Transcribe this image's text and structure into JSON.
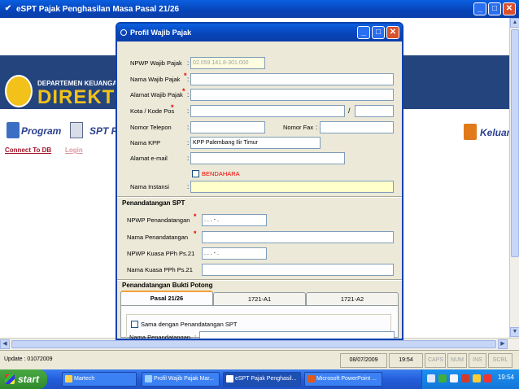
{
  "main": {
    "title": "eSPT Pajak Penghasilan Masa Pasal 21/26",
    "banner_small": "DEPARTEMEN KEUANGAN",
    "banner_big": "DIREKTOR",
    "menu": {
      "program": "Program",
      "spt": "SPT P",
      "keluar": "Keluar"
    },
    "links": {
      "connect": "Connect To DB",
      "login": "Login"
    }
  },
  "dialog": {
    "title": "Profil Wajib Pajak",
    "fields": {
      "npwp_label": "NPWP Wajib Pajak",
      "npwp_value": "02.059.141.8-301.000",
      "nama_label": "Nama Wajib Pajak",
      "nama_value": "",
      "alamat_label": "Alamat Wajib Pajak",
      "alamat_value": "",
      "kota_label": "Kota / Kode Pos",
      "kota_value": "",
      "kodepos_value": "",
      "slash": "/",
      "telp_label": "Nomor Telepon",
      "telp_value": "",
      "fax_label": "Nomor Fax",
      "fax_value": "",
      "kpp_label": "Nama KPP",
      "kpp_value": "KPP Palembang Ilir Timur",
      "email_label": "Alamat e-mail",
      "email_value": "",
      "bendahara_label": "BENDAHARA",
      "instansi_label": "Nama Instansi",
      "instansi_value": ""
    },
    "penandatangan": {
      "section_title": "Penandatangan SPT",
      "npwp_label": "NPWP Penandatangan",
      "npwp_value": "  .   .   .   -   .  ",
      "nama_label": "Nama Penandatangan",
      "nama_value": "",
      "npwp_kuasa_label": "NPWP Kuasa PPh Ps.21",
      "npwp_kuasa_value": "  .   .   .   -   .  ",
      "nama_kuasa_label": "Nama Kuasa PPh Ps.21",
      "nama_kuasa_value": ""
    },
    "bukti_potong": {
      "section_title": "Penandatangan Bukti Potong",
      "tabs": [
        "Pasal 21/26",
        "1721-A1",
        "1721-A2"
      ],
      "same_label": "Sama dengan Penandatangan SPT",
      "nama_label": "Nama Penandatangan"
    }
  },
  "statusbar": {
    "update": "Update : 01072009",
    "date": "08/07/2009",
    "time": "19:54",
    "caps": "CAPS",
    "num": "NUM",
    "ins": "INS",
    "scrl": "SCRL"
  },
  "taskbar": {
    "start": "start",
    "tasks": [
      "Martech",
      "Profil Wajib Pajak Mar...",
      "eSPT Pajak Penghasil...",
      "Microsoft PowerPoint ..."
    ],
    "clock": "19:54"
  },
  "colors": {
    "titlebar": "#0843b8",
    "banner": "#24447e",
    "accent_yellow": "#f2c21a",
    "required": "#e00000"
  }
}
